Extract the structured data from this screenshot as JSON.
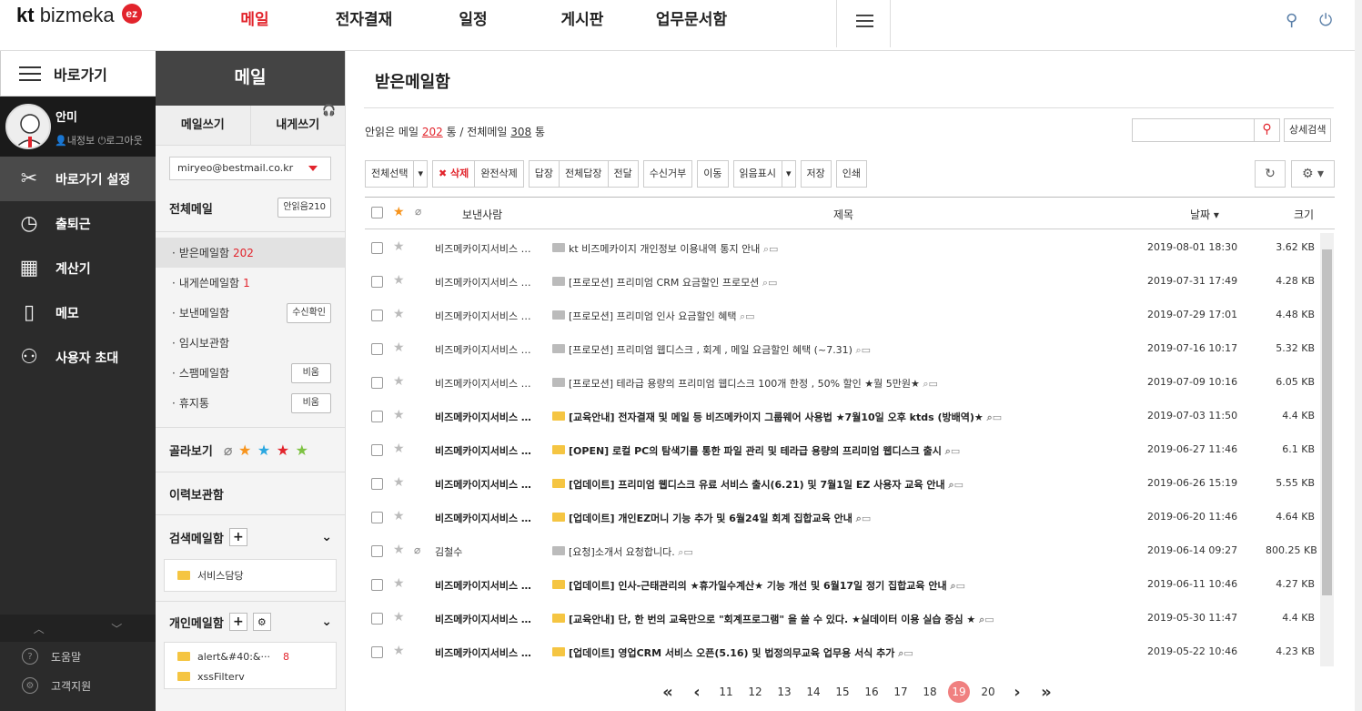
{
  "logo": {
    "kt": "kt",
    "brand": "bizmeka",
    "badge": "ez"
  },
  "gnb": [
    "메일",
    "전자결재",
    "일정",
    "게시판",
    "업무문서함"
  ],
  "left_panel": {
    "header": "바로가기",
    "user": {
      "name": "안미",
      "link_info": "내정보",
      "link_logout": "로그아웃"
    },
    "items": [
      {
        "label": "바로가기 설정",
        "icon": "tools-icon"
      },
      {
        "label": "출퇴근",
        "icon": "clock-icon"
      },
      {
        "label": "계산기",
        "icon": "calculator-icon"
      },
      {
        "label": "메모",
        "icon": "memo-icon"
      },
      {
        "label": "사용자 초대",
        "icon": "invite-icon"
      }
    ],
    "footer": [
      "도움말",
      "고객지원"
    ]
  },
  "mail_sidebar": {
    "title": "메일",
    "write": "메일쓰기",
    "write_self": "내게쓰기",
    "account": "miryeo@bestmail.co.kr",
    "all_mail": "전체메일",
    "unread_btn": "안읽음210",
    "boxes": [
      {
        "label": "받은메일함",
        "count": "202",
        "btn": ""
      },
      {
        "label": "내게쓴메일함",
        "count": "1",
        "btn": ""
      },
      {
        "label": "보낸메일함",
        "count": "",
        "btn": "수신확인"
      },
      {
        "label": "임시보관함",
        "count": "",
        "btn": ""
      },
      {
        "label": "스팸메일함",
        "count": "",
        "btn": "비움"
      },
      {
        "label": "휴지통",
        "count": "",
        "btn": "비움"
      }
    ],
    "pick": "골라보기",
    "history": "이력보관함",
    "search_box": "검색메일함",
    "search_folder": "서비스담당",
    "personal": "개인메일함",
    "personal_folders": [
      {
        "label": "alert&#40:&···",
        "count": "8"
      },
      {
        "label": "xssFilterv",
        "count": ""
      }
    ]
  },
  "content": {
    "title": "받은메일함",
    "summary": {
      "pre": "안읽은 메일 ",
      "unread": "202",
      "mid": " 통 / 전체메일 ",
      "total": "308",
      "post": " 통"
    },
    "detail_search": "상세검색",
    "toolbar": [
      "전체선택",
      "▾",
      "✖ 삭제",
      "완전삭제",
      "답장",
      "전체답장",
      "전달",
      "수신거부",
      "이동",
      "읽음표시",
      "▾",
      "저장",
      "인쇄"
    ],
    "columns": {
      "from": "보낸사람",
      "subject": "제목",
      "date": "날짜 ▾",
      "size": "크기"
    },
    "rows": [
      {
        "from": "비즈메카이지서비스 …",
        "subject": "kt 비즈메카이지 개인정보 이용내역 통지 안내",
        "date": "2019-08-01 18:30",
        "size": "3.62 KB",
        "unread": false,
        "attach": false
      },
      {
        "from": "비즈메카이지서비스 …",
        "subject": "[프로모션] 프리미엄 CRM 요금할인 프로모션",
        "date": "2019-07-31 17:49",
        "size": "4.28 KB",
        "unread": false,
        "attach": false
      },
      {
        "from": "비즈메카이지서비스 …",
        "subject": "[프로모션] 프리미엄 인사 요금할인 혜택",
        "date": "2019-07-29 17:01",
        "size": "4.48 KB",
        "unread": false,
        "attach": false
      },
      {
        "from": "비즈메카이지서비스 …",
        "subject": "[프로모션] 프리미엄 웹디스크 , 회계 , 메일 요금할인 혜택 (~7.31)",
        "date": "2019-07-16 10:17",
        "size": "5.32 KB",
        "unread": false,
        "attach": false
      },
      {
        "from": "비즈메카이지서비스 …",
        "subject": "[프로모션] 테라급 용량의 프리미엄 웹디스크 100개 한정 , 50% 할인 ★월 5만원★",
        "date": "2019-07-09 10:16",
        "size": "6.05 KB",
        "unread": false,
        "attach": false
      },
      {
        "from": "비즈메카이지서비스 …",
        "subject": "[교육안내] 전자결재 및 메일 등 비즈메카이지 그룹웨어 사용법 ★7월10일 오후 ktds (방배역)★",
        "date": "2019-07-03 11:50",
        "size": "4.4 KB",
        "unread": true,
        "attach": false
      },
      {
        "from": "비즈메카이지서비스 …",
        "subject": "[OPEN] 로컬 PC의 탐색기를 통한 파일 관리 및 테라급 용량의 프리미엄 웹디스크 출시",
        "date": "2019-06-27 11:46",
        "size": "6.1 KB",
        "unread": true,
        "attach": false
      },
      {
        "from": "비즈메카이지서비스 …",
        "subject": "[업데이트] 프리미엄 웹디스크 유료 서비스 출시(6.21) 및 7월1일 EZ 사용자 교육 안내",
        "date": "2019-06-26 15:19",
        "size": "5.55 KB",
        "unread": true,
        "attach": false
      },
      {
        "from": "비즈메카이지서비스 …",
        "subject": "[업데이트] 개인EZ머니 기능 추가 및 6월24일 회계 집합교육 안내",
        "date": "2019-06-20 11:46",
        "size": "4.64 KB",
        "unread": true,
        "attach": false
      },
      {
        "from": "김철수",
        "subject": "[요청]소개서 요청합니다.",
        "date": "2019-06-14 09:27",
        "size": "800.25 KB",
        "unread": false,
        "attach": true
      },
      {
        "from": "비즈메카이지서비스 …",
        "subject": "[업데이트] 인사-근태관리의 ★휴가일수계산★ 기능 개선 및 6월17일 정기 집합교육 안내",
        "date": "2019-06-11 10:46",
        "size": "4.27 KB",
        "unread": true,
        "attach": false
      },
      {
        "from": "비즈메카이지서비스 …",
        "subject": "[교육안내] 단, 한 번의 교육만으로 \"회계프로그램\" 을 쓸 수 있다. ★실데이터 이용 실습 중심 ★",
        "date": "2019-05-30 11:47",
        "size": "4.4 KB",
        "unread": true,
        "attach": false
      },
      {
        "from": "비즈메카이지서비스 …",
        "subject": "[업데이트] 영업CRM 서비스 오픈(5.16) 및 법정의무교육 업무용 서식 추가",
        "date": "2019-05-22 10:46",
        "size": "4.23 KB",
        "unread": true,
        "attach": false
      }
    ],
    "pager": {
      "first": "«",
      "prev": "‹",
      "pages": [
        "11",
        "12",
        "13",
        "14",
        "15",
        "16",
        "17",
        "18",
        "19",
        "20"
      ],
      "current": "19",
      "next": "›",
      "last": "»"
    }
  },
  "colors": {
    "accent": "#e2242c",
    "dark": "#2b2b2b",
    "current_page": "#f08080"
  }
}
